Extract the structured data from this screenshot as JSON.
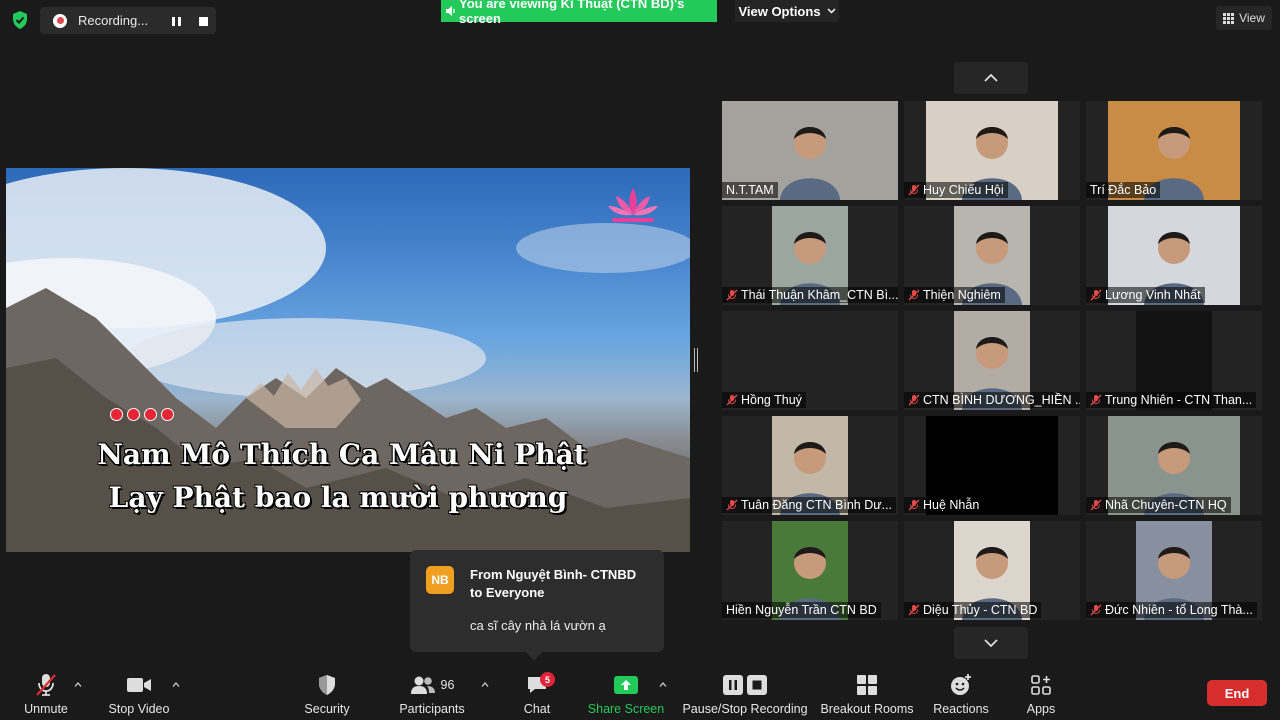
{
  "top": {
    "recording_label": "Recording...",
    "viewing_banner": "You are viewing Kĩ Thuật (CTN BD)'s screen",
    "view_options_label": "View Options",
    "view_label": "View"
  },
  "share": {
    "lyric_line1": "Nam Mô Thích Ca Mâu Ni Phật",
    "lyric_line2": "Lạy Phật bao la mười phương"
  },
  "participants": [
    {
      "name": "N.T.TAM",
      "muted": false
    },
    {
      "name": "Huy Chiếu Hội",
      "muted": true
    },
    {
      "name": "Trí Đắc Bảo",
      "muted": false
    },
    {
      "name": "Thái Thuận Khâm_CTN Bì...",
      "muted": true
    },
    {
      "name": "Thiện Nghiêm",
      "muted": true
    },
    {
      "name": "Lương Vinh Nhất",
      "muted": true
    },
    {
      "name": "Hồng Thuý",
      "muted": true
    },
    {
      "name": "CTN BÌNH DƯƠNG_HIỀN ...",
      "muted": true
    },
    {
      "name": "Trung Nhiên - CTN Than...",
      "muted": true
    },
    {
      "name": "Tuân Đăng CTN Bình Dư...",
      "muted": true
    },
    {
      "name": "Huệ Nhẫn",
      "muted": true
    },
    {
      "name": "Nhã Chuyên-CTN HQ",
      "muted": true
    },
    {
      "name": "Hiền Nguyễn Trần CTN BD",
      "muted": false
    },
    {
      "name": "Diệu Thủy - CTN BD",
      "muted": true
    },
    {
      "name": "Đức Nhiên - tổ Long Thà...",
      "muted": true
    }
  ],
  "chat_toast": {
    "avatar_initials": "NB",
    "from_line1": "From Nguyệt Bình- CTNBD",
    "from_line2": "to Everyone",
    "message": "ca sĩ cây nhà lá vườn ạ"
  },
  "toolbar": {
    "unmute": "Unmute",
    "stop_video": "Stop Video",
    "security": "Security",
    "participants": "Participants",
    "participant_count": "96",
    "chat": "Chat",
    "chat_badge": "5",
    "share_screen": "Share Screen",
    "pause_stop_recording": "Pause/Stop Recording",
    "breakout_rooms": "Breakout Rooms",
    "reactions": "Reactions",
    "apps": "Apps",
    "end": "End"
  },
  "colors": {
    "accent_green": "#23c95a",
    "end_red": "#d62d2d",
    "badge_red": "#e0243a",
    "avatar_orange": "#f0a020"
  }
}
